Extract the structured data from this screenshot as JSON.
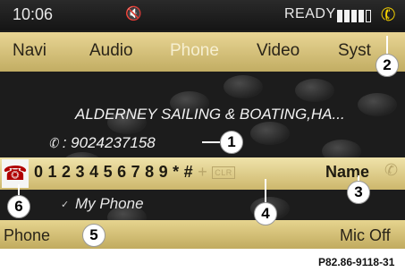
{
  "status": {
    "time": "10:06",
    "mute_icon": "speaker-mute-icon",
    "mute_glyph": "🔇",
    "ready": "READY",
    "phone_icon": "handset-icon",
    "phone_glyph": "✆"
  },
  "menu": {
    "items": [
      "Navi",
      "Audio",
      "Phone",
      "Video",
      "Syst"
    ],
    "active": "Phone"
  },
  "contact": {
    "name": "ALDERNEY SAILING & BOATING,HA...",
    "number_glyph": "✆",
    "number": ": 9024237158"
  },
  "charbar": {
    "hangup_glyph": "☎",
    "digits": [
      "0",
      "1",
      "2",
      "3",
      "4",
      "5",
      "6",
      "7",
      "8",
      "9",
      "*",
      "#"
    ],
    "plus": "+",
    "clr": "CLR",
    "name": "Name",
    "call_glyph": "✆"
  },
  "device": {
    "check_glyph": "✓",
    "name": "My Phone"
  },
  "bottom": {
    "left": "Phone",
    "right": "Mic Off"
  },
  "callouts": {
    "c1": "1",
    "c2": "2",
    "c3": "3",
    "c4": "4",
    "c5": "5",
    "c6": "6"
  },
  "reference": "P82.86-9118-31",
  "colors": {
    "menu_active": "#f6efd1",
    "accent_yellow": "#f5d200",
    "hangup_red": "#b00000"
  }
}
